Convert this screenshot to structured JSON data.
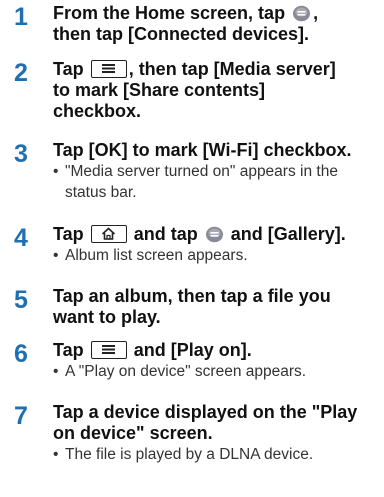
{
  "steps": [
    {
      "number": "1",
      "title_a": "From the Home screen, tap",
      "title_b": ",",
      "title_c": "then tap [Connected devices]."
    },
    {
      "number": "2",
      "title_a": "Tap",
      "title_b": ", then tap [Media server]",
      "title_c": "to mark [Share contents]",
      "title_d": "checkbox."
    },
    {
      "number": "3",
      "title_a": "Tap [OK] to mark [Wi-Fi] checkbox.",
      "note_a": "\"Media server turned on\" appears in the",
      "note_b": "status bar."
    },
    {
      "number": "4",
      "title_a": "Tap",
      "title_b": "and tap",
      "title_c": "and [Gallery].",
      "note_a": "Album list screen appears."
    },
    {
      "number": "5",
      "title_a": "Tap an album, then tap a file you",
      "title_b": "want to play."
    },
    {
      "number": "6",
      "title_a": "Tap",
      "title_b": "and [Play on].",
      "note_a": "A \"Play on device\" screen appears."
    },
    {
      "number": "7",
      "title_a": "Tap a device displayed on the \"Play",
      "title_b": "on device\" screen.",
      "note_a": "The file is played by a DLNA device."
    }
  ],
  "bullet": "•",
  "icons": {
    "app": "apps-icon",
    "menu": "menu-key-icon",
    "home": "home-key-icon"
  },
  "colors": {
    "step_number": "#1f6fb2",
    "app_icon": "#8a8a96"
  }
}
